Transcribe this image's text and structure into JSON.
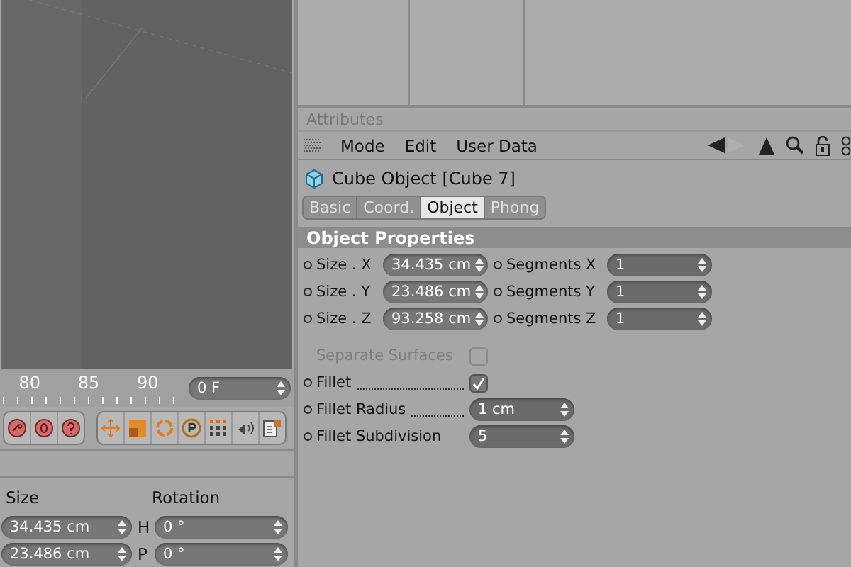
{
  "timeline": {
    "ticks": [
      "80",
      "85",
      "90"
    ],
    "frame_field": "0 F"
  },
  "coordinates": {
    "columns": [
      "Size",
      "Rotation"
    ],
    "rows": [
      {
        "size": "34.435 cm",
        "axis": "H",
        "rotation": "0 °"
      },
      {
        "size": "23.486 cm",
        "axis": "P",
        "rotation": "0 °"
      }
    ]
  },
  "attributes": {
    "title": "Attributes",
    "menu": [
      "Mode",
      "Edit",
      "User Data"
    ],
    "object_title": "Cube Object [Cube 7]",
    "tabs": [
      {
        "label": "Basic",
        "selected": false
      },
      {
        "label": "Coord.",
        "selected": false
      },
      {
        "label": "Object",
        "selected": true
      },
      {
        "label": "Phong",
        "selected": false
      }
    ],
    "section": "Object Properties",
    "size_rows": [
      {
        "label": "Size . X",
        "value": "34.435 cm",
        "segments_label": "Segments X",
        "segments_value": "1"
      },
      {
        "label": "Size . Y",
        "value": "23.486 cm",
        "segments_label": "Segments Y",
        "segments_value": "1"
      },
      {
        "label": "Size . Z",
        "value": "93.258 cm",
        "segments_label": "Segments Z",
        "segments_value": "1"
      }
    ],
    "options": [
      {
        "kind": "checkbox",
        "label": "Separate Surfaces",
        "checked": false,
        "disabled": true
      },
      {
        "kind": "checkbox",
        "label": "Fillet",
        "checked": true,
        "disabled": false
      },
      {
        "kind": "field",
        "label": "Fillet Radius",
        "value": "1 cm",
        "disabled": false
      },
      {
        "kind": "field",
        "label": "Fillet Subdivision",
        "value": "5",
        "disabled": false
      }
    ]
  }
}
